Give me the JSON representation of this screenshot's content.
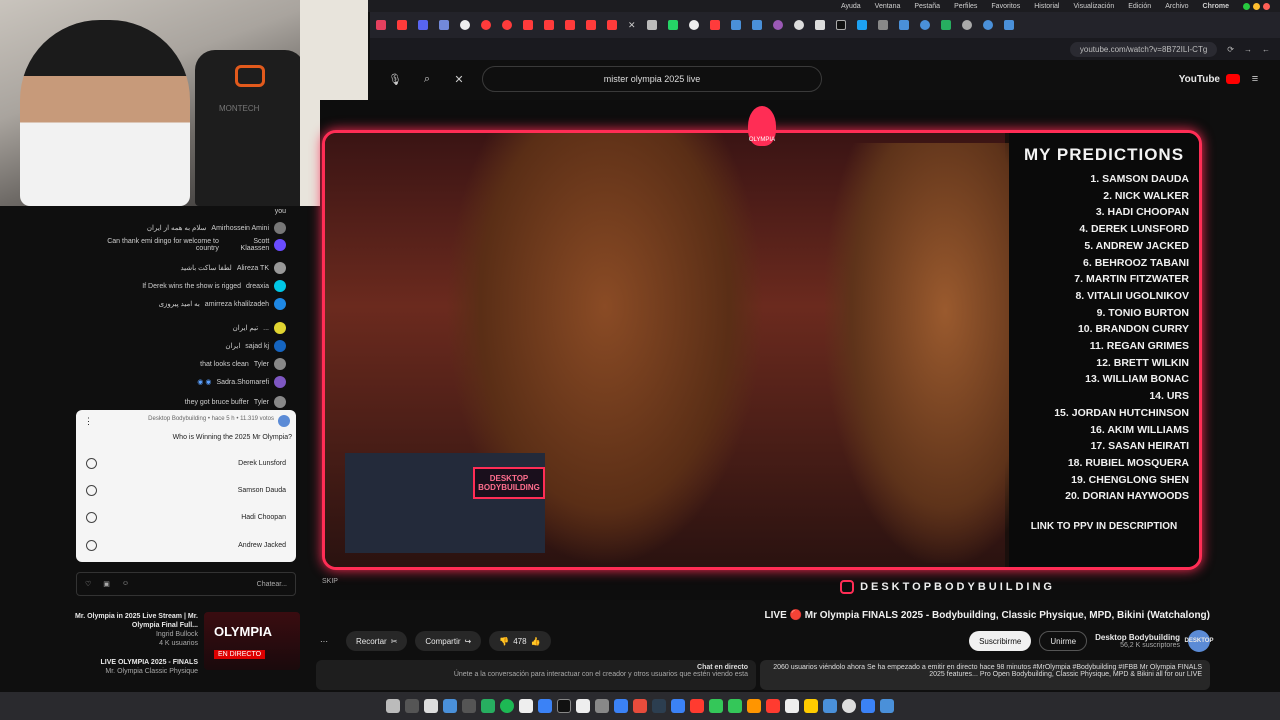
{
  "menubar": {
    "items": [
      "Ayuda",
      "Ventana",
      "Pestaña",
      "Perfiles",
      "Favoritos",
      "Historial",
      "Visualización",
      "Edición",
      "Archivo",
      "Chrome"
    ]
  },
  "browser": {
    "url": "youtube.com/watch?v=8B72ILI-CTg"
  },
  "youtube": {
    "logo": "YouTube",
    "search_query": "mister olympia 2025 live"
  },
  "webcam": {
    "chair_brand": "MONTECH"
  },
  "chat": {
    "messages": [
      {
        "user": "you",
        "text": ""
      },
      {
        "user": "Amirhossein Amini",
        "text": "سلام به همه از ایران"
      },
      {
        "user": "Scott Klaassen",
        "text": "Can thank emi dingo for welcome to country"
      },
      {
        "user": "Alireza TK",
        "text": "لطفا ساکت باشید"
      },
      {
        "user": "dreaxia",
        "text": "If Derek wins the show is rigged"
      },
      {
        "user": "amirreza khalilzadeh",
        "text": "به امید پیروزی"
      },
      {
        "user": "...",
        "text": "تیم ایران"
      },
      {
        "user": "sajad kj",
        "text": "ایران"
      },
      {
        "user": "Tyler",
        "text": "that looks clean"
      },
      {
        "user": "Sadra.Shomarefi",
        "text": ""
      },
      {
        "user": "Tyler",
        "text": "they got bruce buffer"
      }
    ],
    "input_placeholder": "Chatear...",
    "poll": {
      "header": "Desktop Bodybuilding • hace 5 h • 11.319 votos",
      "question": "Who is Winning the 2025 Mr Olympia?",
      "options": [
        "Derek Lunsford",
        "Samson Dauda",
        "Hadi Choopan",
        "Andrew Jacked"
      ]
    }
  },
  "player": {
    "logo_text": "OLYMPIA",
    "overlay_badge": "DESKTOP BODYBUILDING",
    "banner": "DESKTOPBODYBUILDING",
    "skip_tag": "SKIP",
    "predictions": {
      "title": "MY PREDICTIONS",
      "items": [
        "1. SAMSON DAUDA",
        "2. NICK WALKER",
        "3. HADI CHOOPAN",
        "4. DEREK LUNSFORD",
        "5. ANDREW JACKED",
        "6. BEHROOZ TABANI",
        "7. MARTIN FITZWATER",
        "8. VITALII UGOLNIKOV",
        "9. TONIO BURTON",
        "10. BRANDON CURRY",
        "11. REGAN GRIMES",
        "12. BRETT WILKIN",
        "13. WILLIAM BONAC",
        "14. URS",
        "15. JORDAN HUTCHINSON",
        "16. AKIM WILLIAMS",
        "17. SASAN HEIRATI",
        "18. RUBIEL MOSQUERA",
        "19. CHENGLONG SHEN",
        "20. DORIAN HAYWOODS"
      ],
      "link": "LINK TO PPV IN DESCRIPTION"
    }
  },
  "video": {
    "title": "LIVE 🔴 Mr Olympia FINALS 2025 - Bodybuilding, Classic Physique, MPD, Bikini (Watchalong)",
    "channel_name": "Desktop Bodybuilding",
    "channel_subs": "56,2 K suscriptores",
    "avatar_text": "DESKTOP",
    "join_label": "Unirme",
    "subscribe_label": "Suscribirme",
    "like_count": "478",
    "share_label": "Compartir",
    "clip_label": "Recortar",
    "more_label": "···",
    "description": "2060 usuarios viéndolo ahora  Se ha empezado a emitir en directo hace 98 minutos  #MrOlympia #Bodybuilding #IFBB Mr Olympia FINALS 2025 features... Pro Open Bodybuilding, Classic Physique, MPD & Bikini all for our LIVE",
    "chat_title": "Chat en directo",
    "chat_sub": "Únete a la conversación para interactuar con el creador y otros usuarios que estén viendo esta"
  },
  "recommendations": [
    {
      "title": "Mr. Olympia in 2025 Live Stream | Mr. Olympia Final Full...",
      "channel": "Ingrid Bullock",
      "views": "4 K usuarios",
      "thumb_text": "OLYMPIA",
      "live_label": "EN DIRECTO"
    },
    {
      "title": "LIVE OLYMPIA 2025 - FINALS",
      "channel": "Mr. Olympia Classic Physique",
      "views": "",
      "thumb_text": "",
      "live_label": "FINALS"
    }
  ]
}
